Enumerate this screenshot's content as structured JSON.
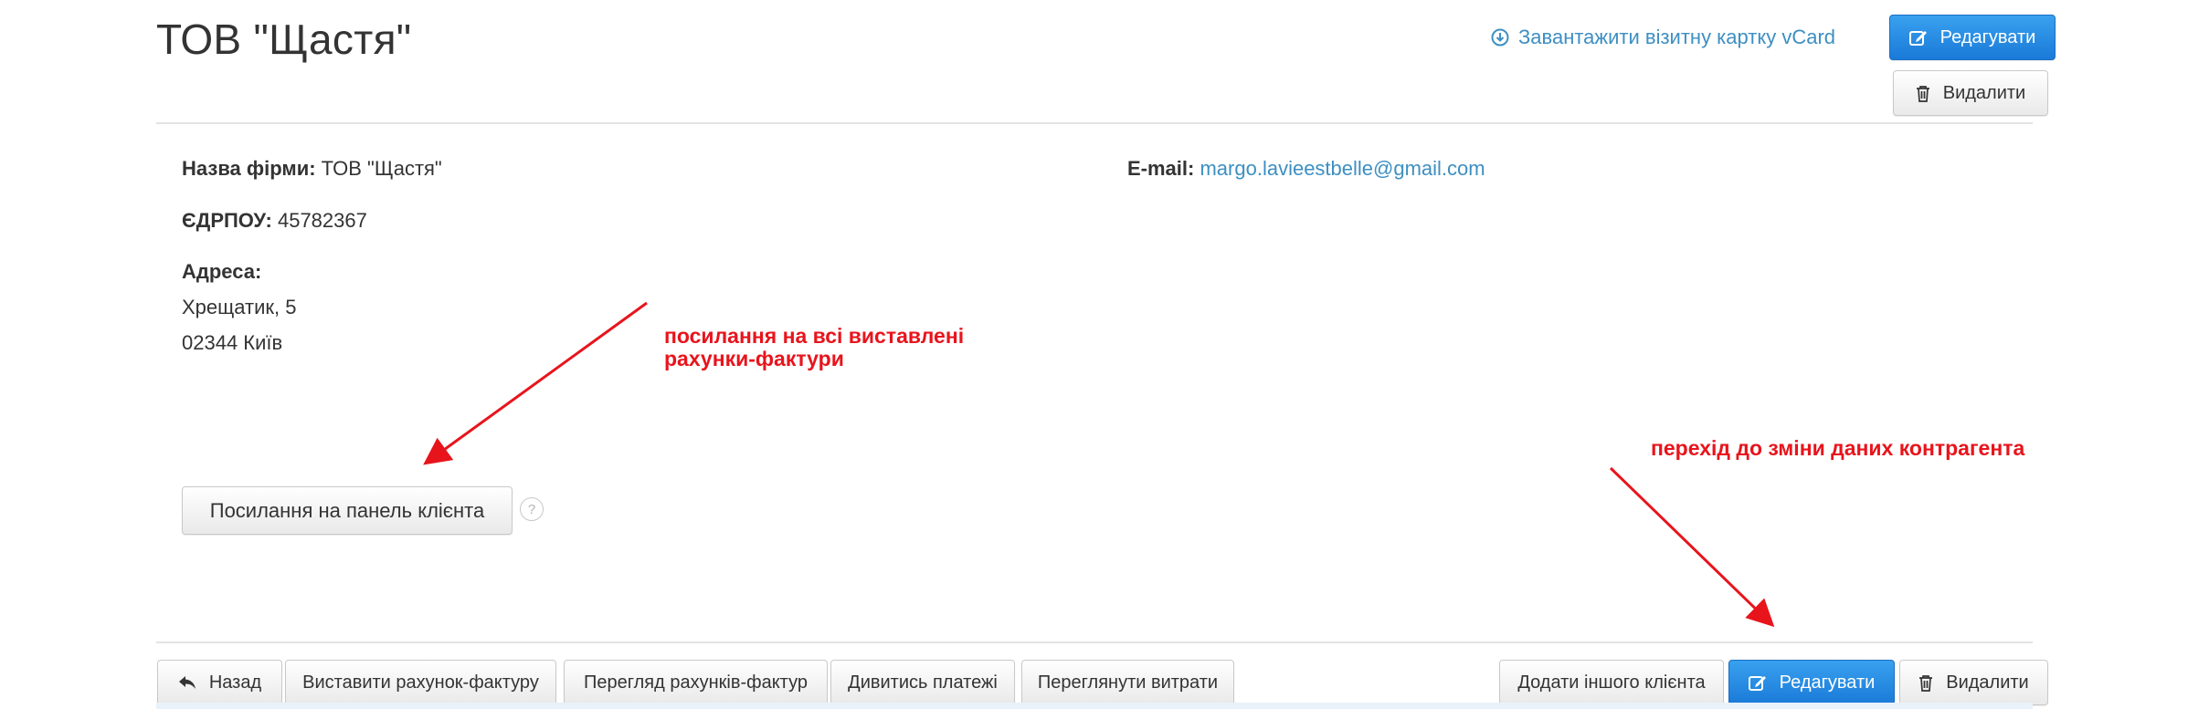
{
  "header": {
    "title": "ТОВ \"Щастя\"",
    "vcard_link": "Завантажити візитну картку vCard",
    "edit_label": "Редагувати",
    "delete_label": "Видалити"
  },
  "details": {
    "firm_label": "Назва фірми:",
    "firm_value": "ТОВ \"Щастя\"",
    "edrpou_label": "ЄДРПОУ:",
    "edrpou_value": "45782367",
    "address_label": "Адреса:",
    "address_line1": "Хрещатик, 5",
    "address_line2": "02344 Київ",
    "email_label": "E-mail:",
    "email_value": "margo.lavieestbelle@gmail.com"
  },
  "client_panel_button": "Посилання на панель клієнта",
  "help_icon_text": "?",
  "annotations": {
    "invoices_line1": "посилання на всі виставлені",
    "invoices_line2": "рахунки-фактури",
    "edit_note": "перехід до зміни даних контрагента"
  },
  "footer": {
    "back": "Назад",
    "create_invoice": "Виставити рахунок-фактуру",
    "view_invoices": "Перегляд рахунків-фактур",
    "view_payments": "Дивитись платежі",
    "view_expenses": "Переглянути витрати",
    "add_client": "Додати іншого клієнта",
    "edit": "Редагувати",
    "delete": "Видалити"
  },
  "icons": {
    "download": "download-circle-icon",
    "edit": "pencil-square-icon",
    "delete": "trash-icon",
    "back": "reply-arrow-icon"
  },
  "colors": {
    "primary": "#1f83de",
    "link": "#3d8fc2",
    "annotation": "#e8141c"
  }
}
